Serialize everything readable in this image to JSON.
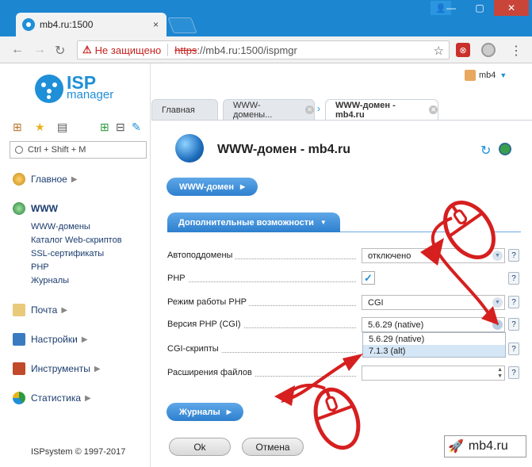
{
  "browser": {
    "tab_title": "mb4.ru:1500",
    "tab_close": "×",
    "not_secure": "Не защищено",
    "url_scheme": "https",
    "url_rest": "://mb4.ru:1500/ispmgr",
    "win_min": "—",
    "win_max": "▢",
    "win_close": "✕",
    "user_chip": "👤"
  },
  "sidebar": {
    "logo_isp": "ISP",
    "logo_manager": "manager",
    "search_placeholder": "Ctrl + Shift + M",
    "sections": [
      {
        "label": "Главное"
      },
      {
        "label": "WWW"
      },
      {
        "label": "Почта"
      },
      {
        "label": "Настройки"
      },
      {
        "label": "Инструменты"
      },
      {
        "label": "Статистика"
      }
    ],
    "www_items": [
      "WWW-домены",
      "Каталог Web-скриптов",
      "SSL-сертификаты",
      "PHP",
      "Журналы"
    ],
    "copyright": "ISPsystem © 1997-2017"
  },
  "header": {
    "user": "mb4"
  },
  "tabs": [
    {
      "label": "Главная"
    },
    {
      "label": "WWW-домены..."
    },
    {
      "label": "WWW-домен - mb4.ru"
    }
  ],
  "page": {
    "title": "WWW-домен - mb4.ru",
    "www_domain_btn": "WWW-домен",
    "section_label": "Дополнительные возможности",
    "fields": [
      {
        "label": "Автоподдомены",
        "value": "отключено"
      },
      {
        "label": "PHP",
        "value": "✓"
      },
      {
        "label": "Режим работы PHP",
        "value": "CGI"
      },
      {
        "label": "Версия PHP (CGI)",
        "value": "5.6.29 (native)"
      },
      {
        "label": "CGI-скрипты",
        "value": ""
      },
      {
        "label": "Расширения файлов",
        "value": ""
      }
    ],
    "dropdown_options": [
      "5.6.29 (native)",
      "7.1.3 (alt)"
    ],
    "journals_btn": "Журналы",
    "ok_btn": "Ok",
    "cancel_btn": "Отмена",
    "help": "?"
  },
  "watermark": "mb4.ru"
}
